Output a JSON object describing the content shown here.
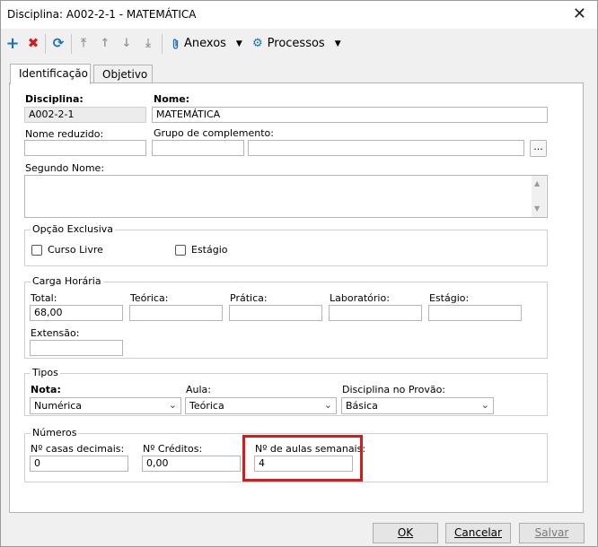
{
  "window": {
    "title": "Disciplina: A002-2-1 - MATEMÁTICA"
  },
  "toolbar": {
    "anexos_label": "Anexos",
    "processos_label": "Processos"
  },
  "tabs": [
    {
      "label": "Identificação",
      "active": true
    },
    {
      "label": "Objetivo",
      "active": false
    }
  ],
  "form": {
    "disciplina_label": "Disciplina:",
    "disciplina_value": "A002-2-1",
    "nome_label": "Nome:",
    "nome_value": "MATEMÁTICA",
    "nome_reduzido_label": "Nome reduzido:",
    "nome_reduzido_value": "",
    "grupo_label": "Grupo de complemento:",
    "grupo_code_value": "",
    "grupo_desc_value": "",
    "grupo_lookup_label": "...",
    "segundo_nome_label": "Segundo Nome:",
    "segundo_nome_value": ""
  },
  "opcao_exclusiva": {
    "title": "Opção Exclusiva",
    "curso_livre_label": "Curso Livre",
    "curso_livre_checked": false,
    "estagio_label": "Estágio",
    "estagio_checked": false
  },
  "carga_horaria": {
    "title": "Carga Horária",
    "total_label": "Total:",
    "total_value": "68,00",
    "teorica_label": "Teórica:",
    "teorica_value": "",
    "pratica_label": "Prática:",
    "pratica_value": "",
    "laboratorio_label": "Laboratório:",
    "laboratorio_value": "",
    "estagio_label": "Estágio:",
    "estagio_value": "",
    "extensao_label": "Extensão:",
    "extensao_value": ""
  },
  "tipos": {
    "title": "Tipos",
    "nota_label": "Nota:",
    "nota_value": "Numérica",
    "aula_label": "Aula:",
    "aula_value": "Teórica",
    "provao_label": "Disciplina no Provão:",
    "provao_value": "Básica"
  },
  "numeros": {
    "title": "Números",
    "casas_label": "Nº casas decimais:",
    "casas_value": "0",
    "creditos_label": "Nº Créditos:",
    "creditos_value": "0,00",
    "aulas_label": "Nº de aulas semanais:",
    "aulas_value": "4"
  },
  "footer": {
    "ok_label": "OK",
    "cancelar_label": "Cancelar",
    "salvar_label": "Salvar"
  },
  "colors": {
    "accent_blue": "#1a6fc2",
    "delete_red": "#d11b1b",
    "highlight_red": "#d91a1a"
  }
}
